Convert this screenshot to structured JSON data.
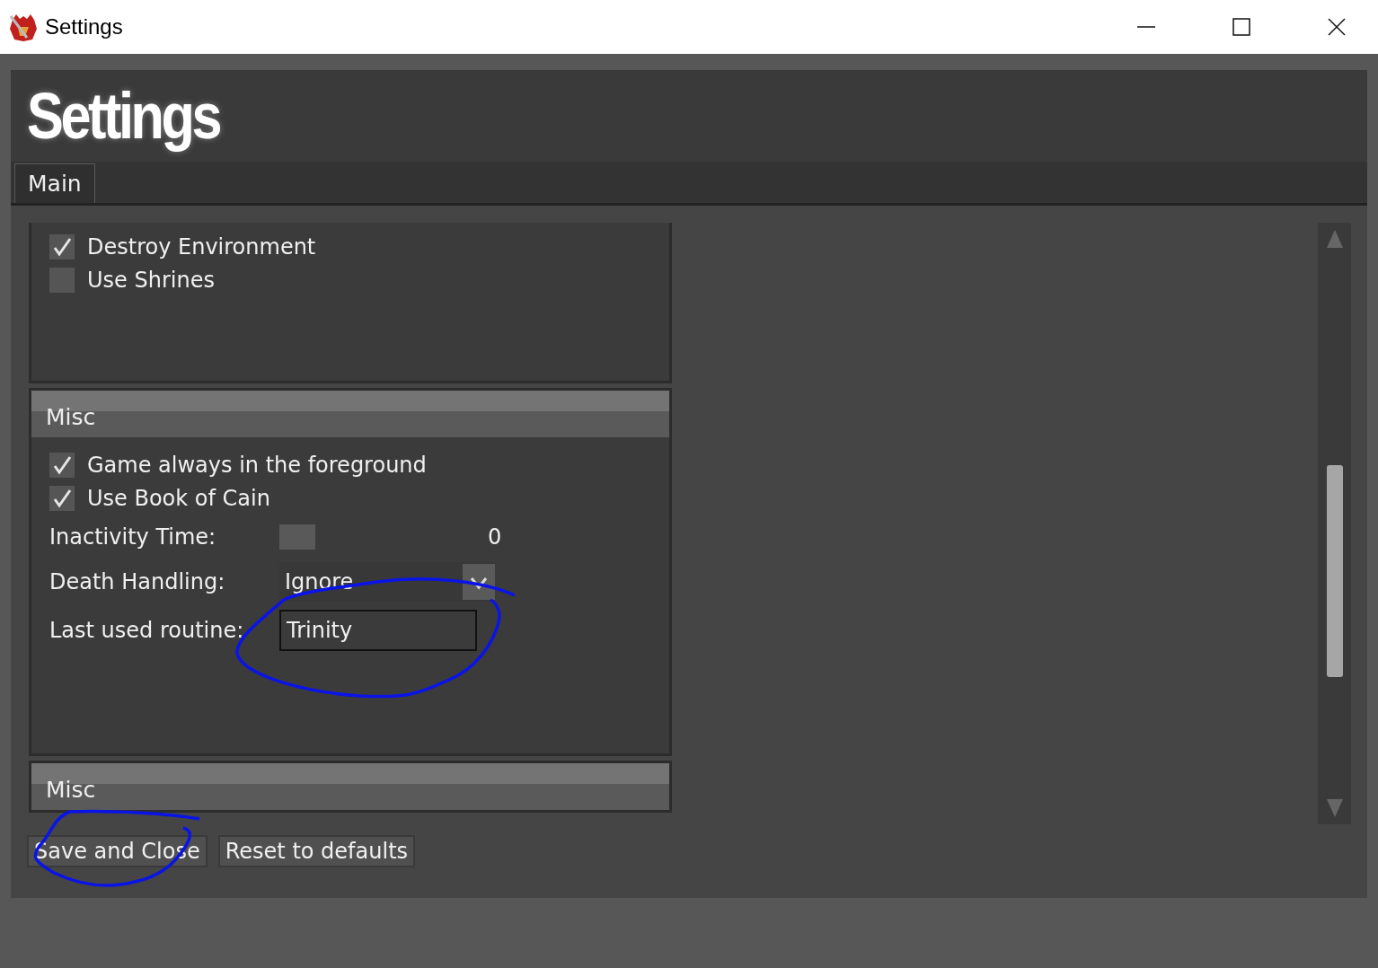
{
  "window": {
    "title": "Settings"
  },
  "header": {
    "title": "Settings"
  },
  "tabs": [
    {
      "label": "Main",
      "selected": true
    }
  ],
  "groups": [
    {
      "checkboxes": [
        {
          "label": "Destroy Environment",
          "checked": true
        },
        {
          "label": "Use Shrines",
          "checked": false
        }
      ]
    },
    {
      "title": "Misc",
      "checkboxes": [
        {
          "label": "Game always in the foreground",
          "checked": true
        },
        {
          "label": "Use Book of Cain",
          "checked": true
        }
      ],
      "fields": [
        {
          "kind": "slider",
          "label": "Inactivity Time:",
          "level": 0,
          "reading": "0"
        },
        {
          "kind": "dropdown",
          "label": "Death Handling:",
          "value": "Ignore"
        },
        {
          "kind": "text",
          "label": "Last used routine:",
          "value": "Trinity"
        }
      ]
    },
    {
      "title": "Misc"
    }
  ],
  "buttons": [
    "Save and Close",
    "Reset to defaults"
  ]
}
